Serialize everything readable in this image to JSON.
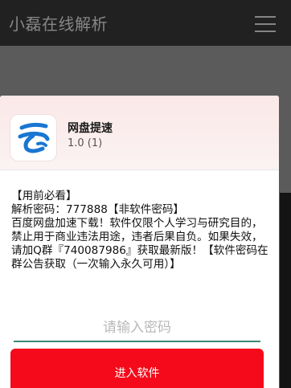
{
  "app_bar": {
    "title": "小磊在线解析"
  },
  "dialog": {
    "app_name": "网盘提速",
    "app_version": "1.0 (1)",
    "notice_lines": [
      "【用前必看】",
      "解析密码：777888【非软件密码】",
      "百度网盘加速下载！软件仅限个人学习与研究目的，禁止用于商业违法用途，违者后果自负。如果失效，请加Q群『740087986』获取最新版！【软件密码在群公告获取（一次输入永久可用）】"
    ],
    "password_input": {
      "placeholder": "请输入密码",
      "value": ""
    },
    "enter_button_label": "进入软件"
  },
  "colors": {
    "app_bar_bg": "#212121",
    "backdrop": "#5b5b5b",
    "accent_red": "#f40a1a",
    "input_underline": "#3a8a74",
    "logo_blue": "#1976d2"
  },
  "icons": {
    "menu": "menu-icon",
    "app_logo": "cloud-logo-icon"
  }
}
